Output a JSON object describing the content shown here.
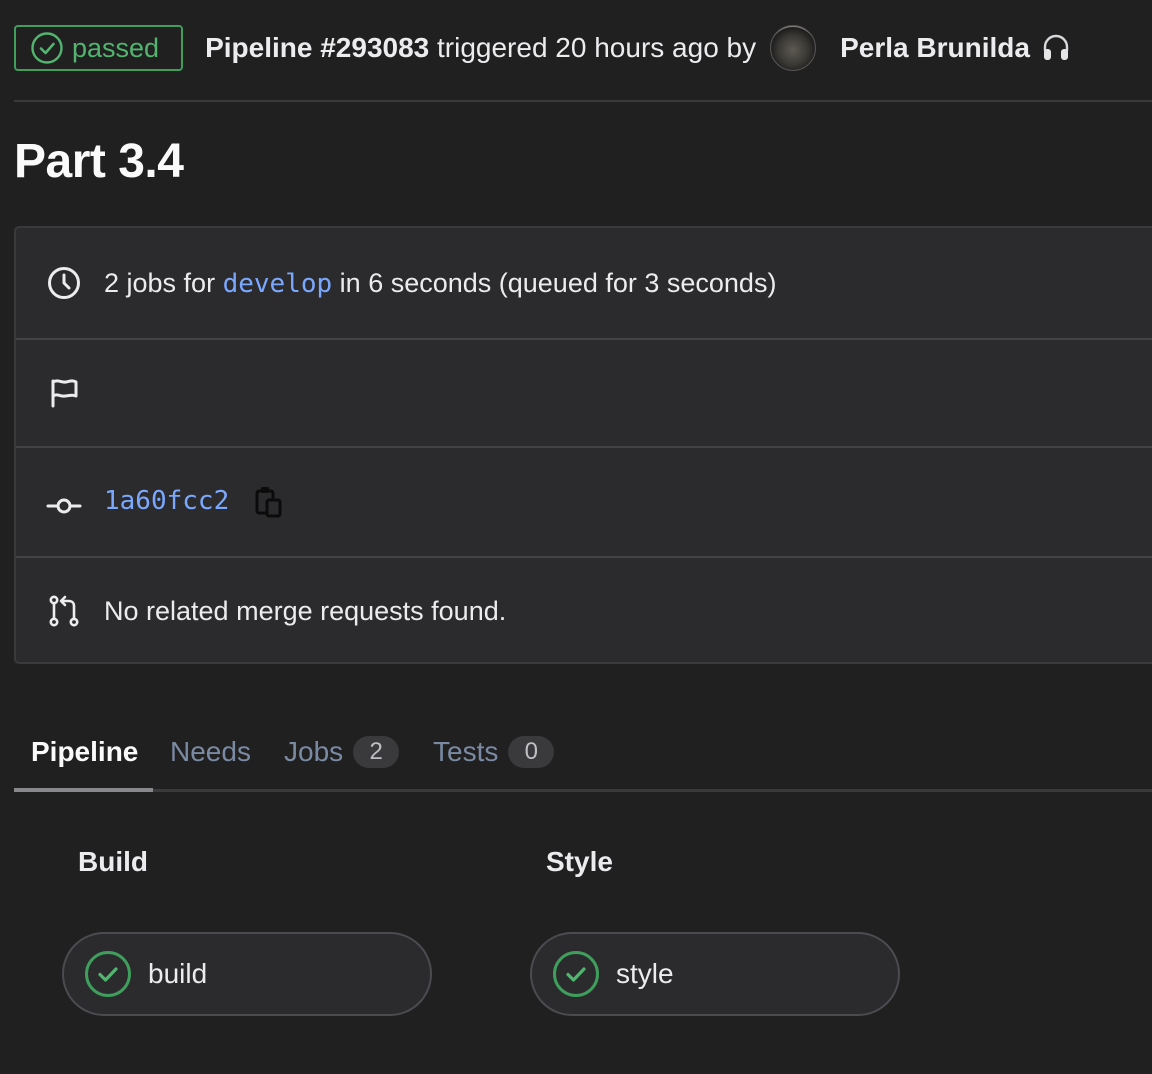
{
  "header": {
    "status": "passed",
    "pipeline_id": "Pipeline #293083",
    "triggered_text": "triggered 20 hours ago by",
    "author": "Perla Brunilda",
    "status_color": "#52b46f"
  },
  "title": "Part 3.4",
  "info": {
    "jobs_prefix": "2 jobs for",
    "branch": "develop",
    "jobs_suffix": "in 6 seconds (queued for 3 seconds)",
    "commit_sha": "1a60fcc2",
    "merge_requests": "No related merge requests found."
  },
  "tabs": [
    {
      "label": "Pipeline"
    },
    {
      "label": "Needs"
    },
    {
      "label": "Jobs",
      "count": "2"
    },
    {
      "label": "Tests",
      "count": "0"
    }
  ],
  "stages": [
    {
      "title": "Build",
      "job": "build"
    },
    {
      "title": "Style",
      "job": "style"
    }
  ],
  "colors": {
    "accent_link": "#7aa8ff",
    "success": "#52b46f",
    "background": "#202021"
  }
}
